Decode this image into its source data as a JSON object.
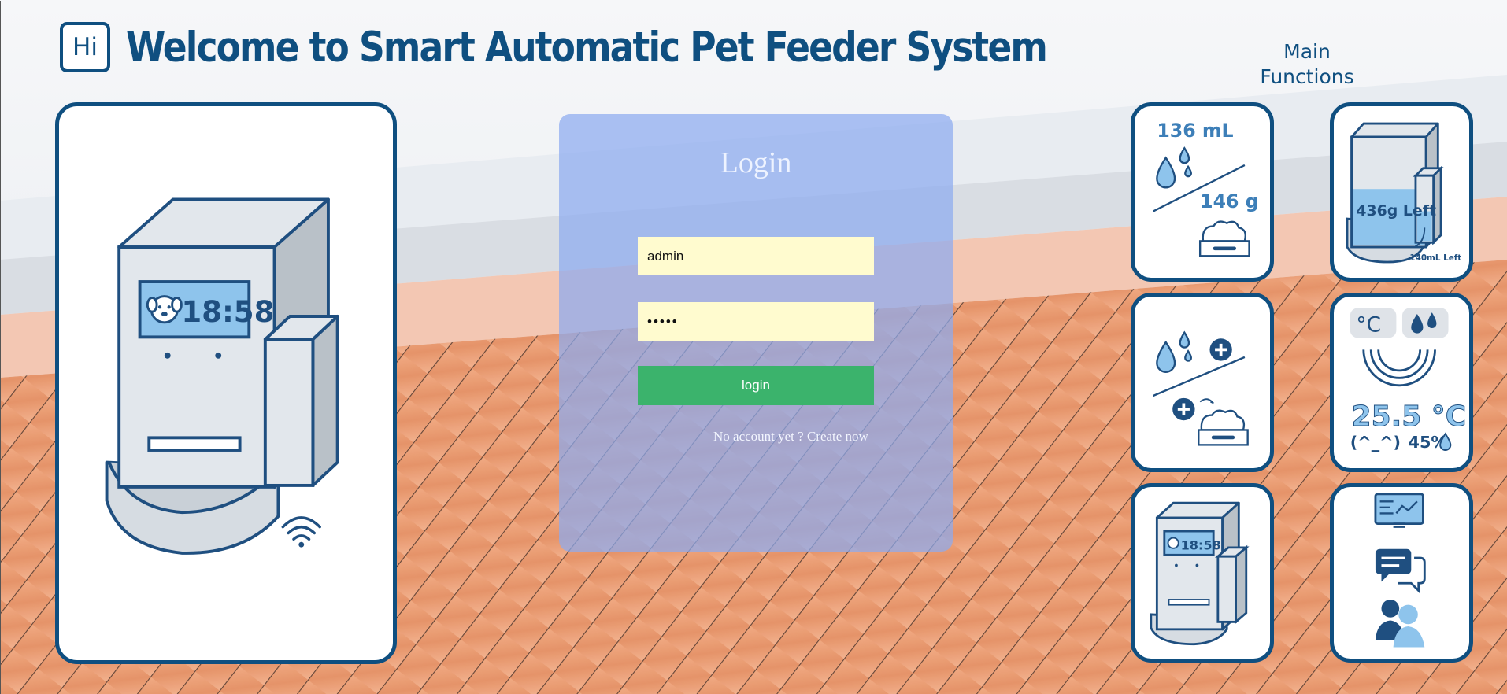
{
  "header": {
    "badge": "Hi",
    "title": "Welcome to Smart Automatic Pet Feeder System"
  },
  "functions_heading": {
    "line1": "Main",
    "line2": "Functions"
  },
  "device": {
    "clock": "18:58"
  },
  "login": {
    "title": "Login",
    "username_value": "admin",
    "password_value": "•••••",
    "button_label": "login",
    "create_account_link": "No account yet ? Create now"
  },
  "tiles": {
    "consumption": {
      "water": "136 mL",
      "food": "146 g"
    },
    "remaining": {
      "food_left": "436g Left",
      "water_left": "140mL Left"
    },
    "environment": {
      "temperature_symbol": "°C",
      "temperature": "25.5 °C",
      "face": "(^_^)",
      "humidity": "45%"
    },
    "device_clock": "18:58"
  },
  "colors": {
    "brand": "#0f4f80",
    "login_button": "#3bb36c",
    "input_background": "#fffbcf",
    "water_blue": "#8ec4ec",
    "wood_floor": "#e8946a"
  },
  "icons": [
    "hi-badge-icon",
    "water-drop-icon",
    "food-bowl-icon",
    "plus-icon",
    "thermometer-icon",
    "humidity-icon",
    "wifi-icon",
    "dashboard-icon",
    "chat-icon",
    "users-icon",
    "dog-face-icon"
  ]
}
